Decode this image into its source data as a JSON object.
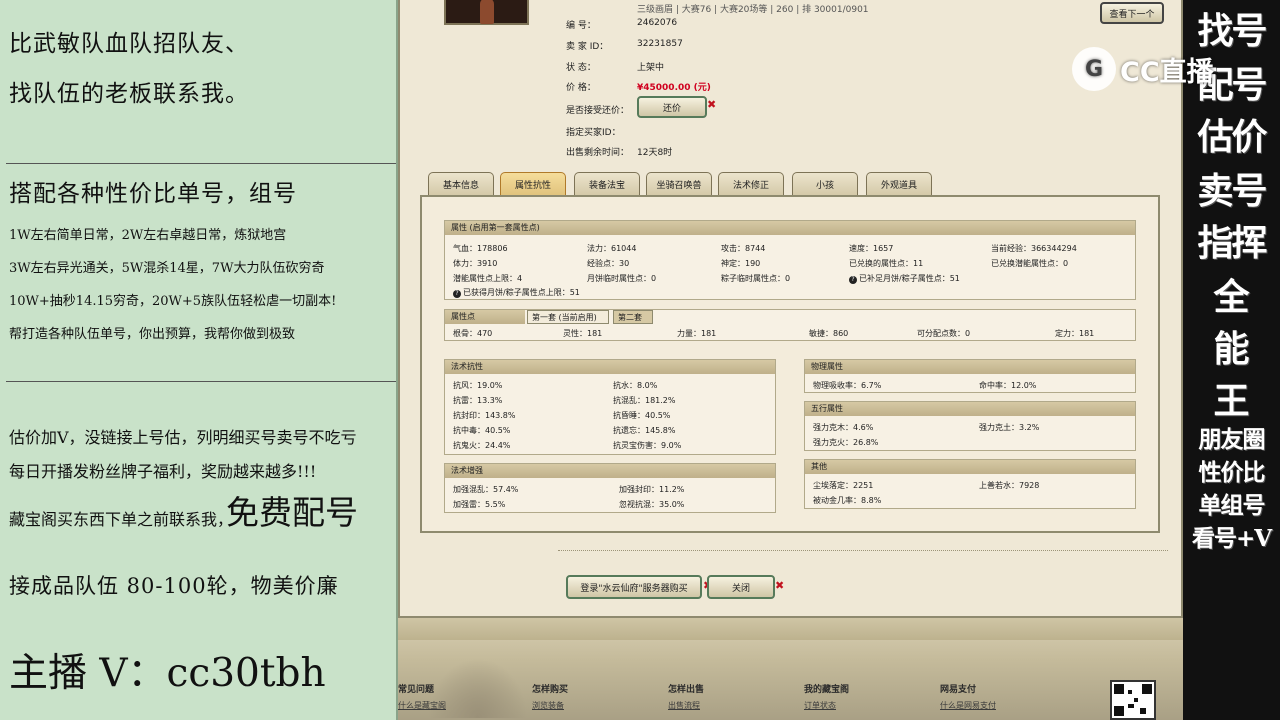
{
  "left_panel": {
    "line1": "比武敏队血队招队友、",
    "line2": "找队伍的老板联系我。",
    "heading2": "搭配各种性价比单号，组号",
    "detail1": "1W左右简单日常，2W左右卓越日常，炼狱地宫",
    "detail2": "3W左右异光通关，5W混杀14星，7W大力队伍砍穷奇",
    "detail3": "10W+抽秒14.15穷奇，20W+5族队伍轻松虐一切副本!",
    "detail4": "帮打造各种队伍单号，你出预算，我帮你做到极致",
    "note1": "估价加V，没链接上号估，列明细买号卖号不吃亏",
    "note2": "每日开播发粉丝牌子福利，奖励越来越多!!!",
    "note3_prefix": "藏宝阁买东西下单之前联系我，",
    "note3_big": "免费配号",
    "note4": "接成品队伍 80-100轮，物美价廉",
    "anchor": "主播 V：cc30tbh"
  },
  "right_panel": {
    "col_chars": [
      "找号",
      "配号",
      "估价",
      "卖号",
      "指挥",
      "全",
      "能",
      "王"
    ],
    "lines": [
      "朋友圈",
      "性价比",
      "单组号",
      "看号+V"
    ]
  },
  "watermark": {
    "text": "CC直播",
    "icon_name": "cc-logo-icon"
  },
  "listing": {
    "number_label": "编        号：",
    "number_value": "2462076",
    "seller_label": "卖   家   ID：",
    "seller_value": "32231857",
    "status_label": "状        态：",
    "status_value": "上架中",
    "price_label": "价        格：",
    "price_value": "¥45000.00 (元)",
    "bargain_label": "是否接受还价：",
    "bargain_button": "还价",
    "buyer_label": "指定买家ID：",
    "buyer_value": "",
    "remain_label": "出售剩余时间：",
    "remain_value": "12天8时",
    "view_next": "查看下一个",
    "top_row": "三级画眉 | 大赛76 | 大赛20场等 | 260 | 排 30001/0901"
  },
  "tabs": [
    "基本信息",
    "属性抗性",
    "装备法宝",
    "坐骑召唤兽",
    "法术修正",
    "小孩",
    "外观道具"
  ],
  "attributes": {
    "header": "属性 (启用第一套属性点)",
    "rows": [
      [
        "气血：178806",
        "法力：61044",
        "攻击：8744",
        "速度：1657",
        "当前经验：366344294"
      ],
      [
        "体力：3910",
        "经验点：30",
        "神定：190",
        "已兑换的属性点：11",
        "已兑换潜能属性点：0"
      ],
      [
        "潜能属性点上限：4",
        "月饼临时属性点：0",
        "粽子临时属性点：0",
        "已补足月饼/粽子属性点：51",
        ""
      ]
    ],
    "extra": "已获得月饼/粽子属性点上限：51"
  },
  "points": {
    "header": "属性点",
    "tab1": "第一套 (当前启用)",
    "tab2": "第二套",
    "values": [
      "根骨：470",
      "灵性：181",
      "力量：181",
      "敏捷：860",
      "可分配点数：0",
      "定力：181"
    ]
  },
  "resist": {
    "header": "法术抗性",
    "items": [
      [
        "抗风：19.0%",
        "抗水：8.0%"
      ],
      [
        "抗雷：13.3%",
        "抗混乱：181.2%"
      ],
      [
        "抗封印：143.8%",
        "抗昏睡：40.5%"
      ],
      [
        "抗中毒：40.5%",
        "抗遗忘：145.8%"
      ],
      [
        "抗鬼火：24.4%",
        "抗灵宝伤害：9.0%"
      ]
    ]
  },
  "enhance": {
    "header": "法术增强",
    "items": [
      [
        "加强混乱：57.4%",
        "加强封印：11.2%"
      ],
      [
        "加强雷：5.5%",
        "忽视抗混：35.0%"
      ]
    ]
  },
  "physical": {
    "header": "物理属性",
    "items": [
      "物理吸收率：6.7%",
      "命中率：12.0%"
    ]
  },
  "five": {
    "header": "五行属性",
    "items": [
      "强力克木：4.6%",
      "强力克土：3.2%",
      "强力克火：26.8%"
    ]
  },
  "other": {
    "header": "其他",
    "items": [
      "尘埃落定：2251",
      "上善若水：7928",
      "被动金几率：8.8%"
    ]
  },
  "bottom_buttons": {
    "login": "登录\"水云仙府\"服务器购买",
    "close": "关闭"
  },
  "footer": {
    "cols": [
      "常见问题",
      "怎样购买",
      "怎样出售",
      "我的藏宝阁",
      "网易支付"
    ],
    "links": [
      "什么是藏宝阁",
      "浏览装备",
      "出售流程",
      "订单状态",
      "什么是网易支付"
    ]
  },
  "colors": {
    "price": "#d0001f",
    "left_bg": "#c9e2c9",
    "button_border": "#567a5a"
  }
}
